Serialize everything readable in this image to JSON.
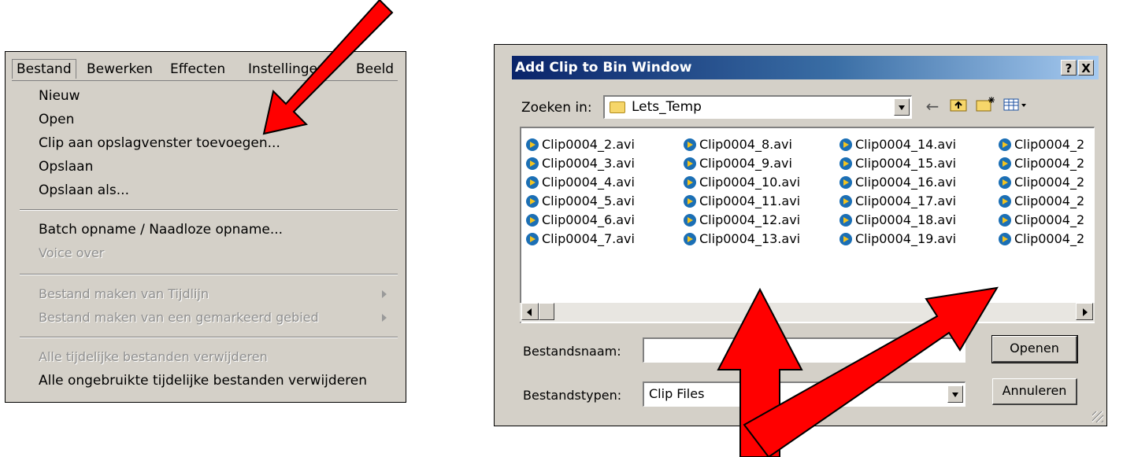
{
  "menu": {
    "menubar": [
      "Bestand",
      "Bewerken",
      "Effecten",
      "Instellingen",
      "Beeld"
    ],
    "items": [
      {
        "label": "Nieuw",
        "enabled": true
      },
      {
        "label": "Open",
        "enabled": true
      },
      {
        "label": "Clip aan opslagvenster toevoegen...",
        "enabled": true
      },
      {
        "label": "Opslaan",
        "enabled": true
      },
      {
        "label": "Opslaan als...",
        "enabled": true
      },
      {
        "label": "Batch opname / Naadloze opname...",
        "enabled": true
      },
      {
        "label": "Voice over",
        "enabled": false
      },
      {
        "label": "Bestand maken van Tijdlijn",
        "enabled": false
      },
      {
        "label": "Bestand maken van een gemarkeerd gebied",
        "enabled": false
      },
      {
        "label": "Alle tijdelijke bestanden verwijderen",
        "enabled": false
      },
      {
        "label": "Alle ongebruikte tijdelijke bestanden verwijderen",
        "enabled": true
      }
    ]
  },
  "dialog": {
    "title": "Add Clip to Bin Window",
    "help_label": "?",
    "close_label": "X",
    "lookin_label": "Zoeken in:",
    "lookin_value": "Lets_Temp",
    "files": [
      [
        "Clip0004_2.avi",
        "Clip0004_3.avi",
        "Clip0004_4.avi",
        "Clip0004_5.avi",
        "Clip0004_6.avi",
        "Clip0004_7.avi"
      ],
      [
        "Clip0004_8.avi",
        "Clip0004_9.avi",
        "Clip0004_10.avi",
        "Clip0004_11.avi",
        "Clip0004_12.avi",
        "Clip0004_13.avi"
      ],
      [
        "Clip0004_14.avi",
        "Clip0004_15.avi",
        "Clip0004_16.avi",
        "Clip0004_17.avi",
        "Clip0004_18.avi",
        "Clip0004_19.avi"
      ],
      [
        "Clip0004_2",
        "Clip0004_2",
        "Clip0004_2",
        "Clip0004_2",
        "Clip0004_2",
        "Clip0004_2"
      ]
    ],
    "filename_label": "Bestandsnaam:",
    "filename_value": "",
    "filetype_label": "Bestandstypen:",
    "filetype_value": "Clip Files",
    "open_label": "Openen",
    "cancel_label": "Annuleren"
  },
  "colors": {
    "titlebar_start": "#0a246a",
    "titlebar_end": "#a6caf0",
    "arrow_fill": "#ff0000",
    "window_face": "#d4d0c8"
  }
}
